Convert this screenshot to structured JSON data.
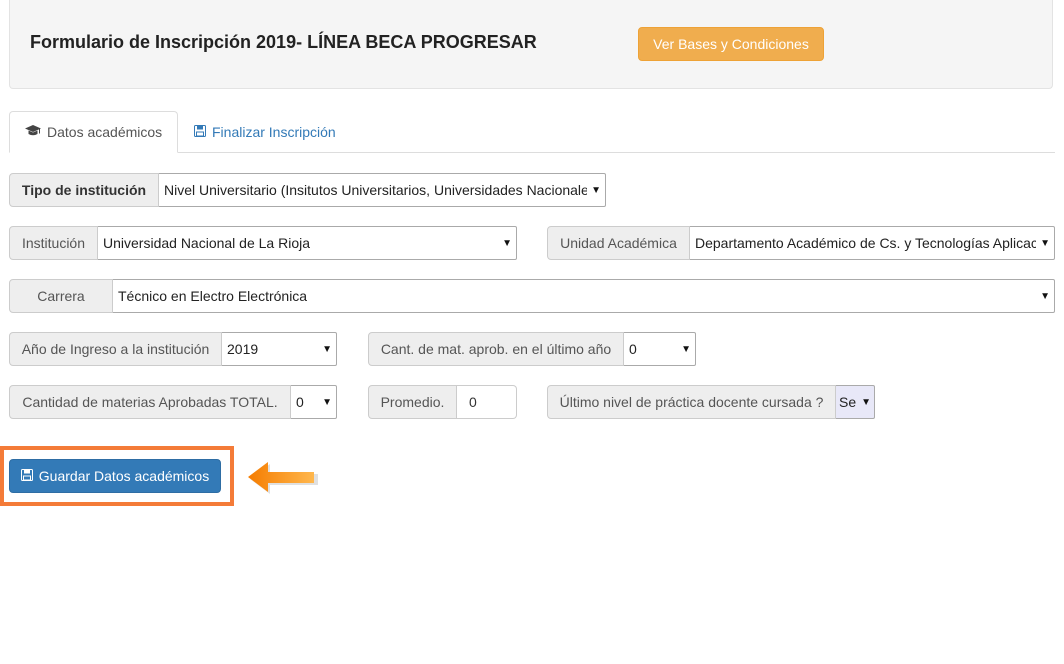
{
  "header": {
    "title": "Formulario de Inscripción 2019- LÍNEA BECA PROGRESAR",
    "bases_button": "Ver Bases y Condiciones"
  },
  "tabs": [
    {
      "label": "Datos académicos",
      "icon": "graduation-cap-icon",
      "active": true
    },
    {
      "label": "Finalizar Inscripción",
      "icon": "floppy-disk-icon",
      "active": false
    }
  ],
  "form": {
    "tipo_institucion": {
      "label": "Tipo de institución",
      "value": "Nivel Universitario (Insitutos Universitarios, Universidades Nacionale"
    },
    "institucion": {
      "label": "Institución",
      "value": "Universidad Nacional de La Rioja"
    },
    "unidad_academica": {
      "label": "Unidad Académica",
      "value": "Departamento Académico de Cs. y Tecnologías Aplicac"
    },
    "carrera": {
      "label": "Carrera",
      "value": "Técnico en Electro Electrónica"
    },
    "anio_ingreso": {
      "label": "Año de Ingreso a la institución",
      "value": "2019"
    },
    "cant_mat_ultimo": {
      "label": "Cant. de mat. aprob. en el último año",
      "value": "0"
    },
    "cant_mat_total": {
      "label": "Cantidad de materias Aprobadas TOTAL.",
      "value": "0"
    },
    "promedio": {
      "label": "Promedio.",
      "value": "0"
    },
    "practica_docente": {
      "label": "Último nivel de práctica docente cursada ?",
      "value": "Se"
    }
  },
  "save_button": "Guardar Datos académicos",
  "colors": {
    "warning": "#f0ad4e",
    "primary": "#337ab7",
    "highlight": "#f47b38"
  }
}
